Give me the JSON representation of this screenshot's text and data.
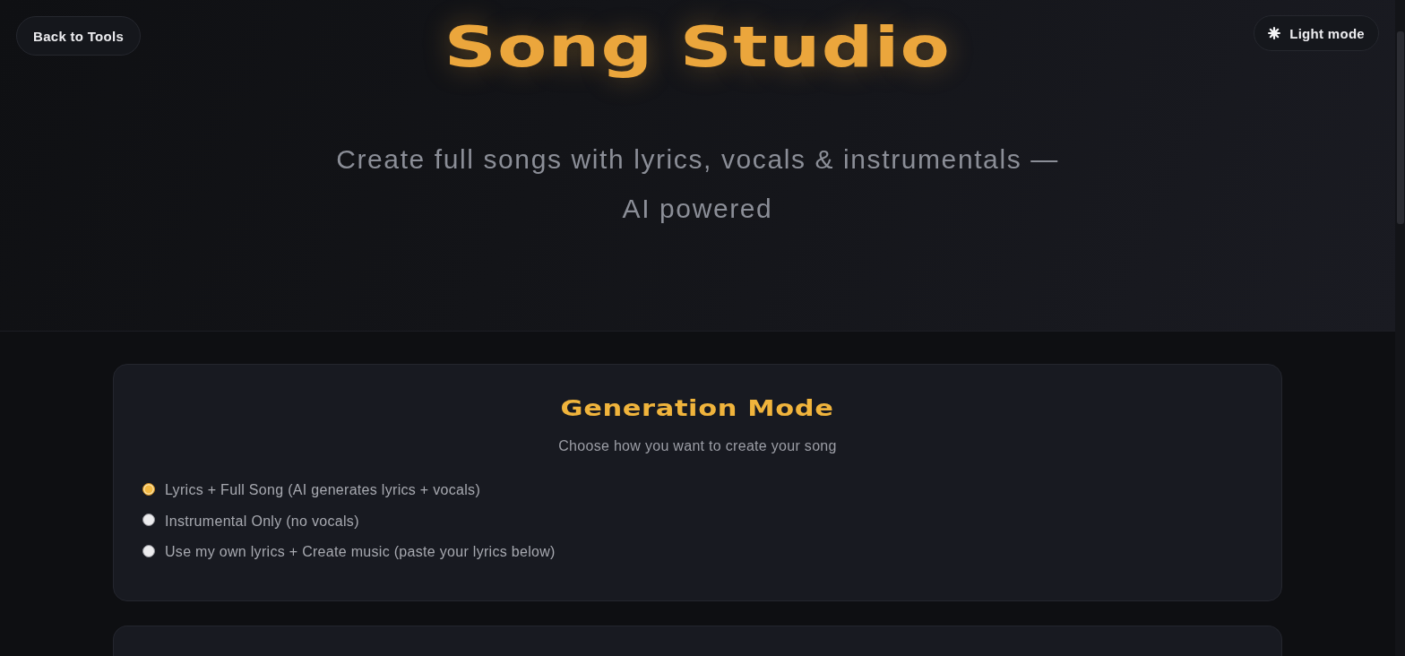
{
  "header": {
    "back_button": "Back to Tools",
    "title": "Song Studio",
    "theme_toggle": "Light mode",
    "subtitle": "Create full songs with lyrics, vocals & instrumentals — AI powered"
  },
  "generation_mode": {
    "title": "Generation Mode",
    "description": "Choose how you want to create your song",
    "options": [
      {
        "label": "Lyrics + Full Song (AI generates lyrics + vocals)",
        "selected": true
      },
      {
        "label": "Instrumental Only (no vocals)",
        "selected": false
      },
      {
        "label": "Use my own lyrics + Create music (paste your lyrics below)",
        "selected": false
      }
    ]
  }
}
